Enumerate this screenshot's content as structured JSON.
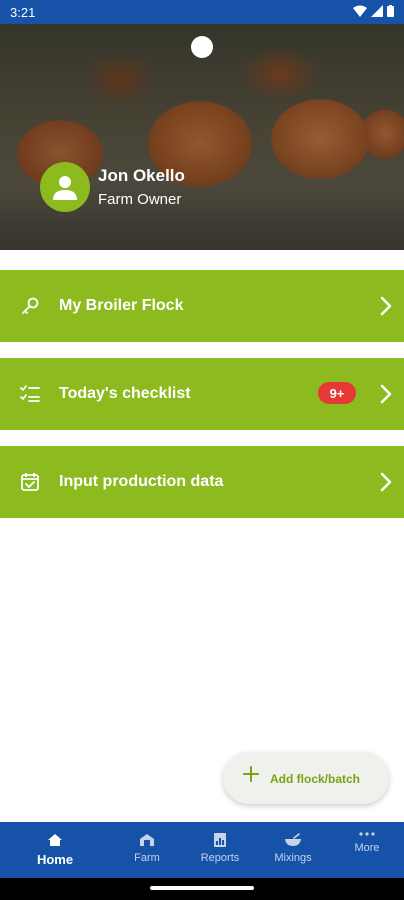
{
  "status_bar": {
    "time": "3:21"
  },
  "profile": {
    "name": "Jon Okello",
    "role": "Farm Owner"
  },
  "menu": [
    {
      "label": "My Broiler Flock",
      "icon": "key-icon"
    },
    {
      "label": "Today's checklist",
      "icon": "checklist-icon",
      "badge": "9+"
    },
    {
      "label": "Input production data",
      "icon": "calendar-check-icon"
    }
  ],
  "fab": {
    "label": "Add flock/batch",
    "icon": "plus-icon"
  },
  "nav": [
    {
      "label": "Home",
      "icon": "home-icon",
      "active": true
    },
    {
      "label": "Farm",
      "icon": "barn-icon"
    },
    {
      "label": "Reports",
      "icon": "report-icon"
    },
    {
      "label": "Mixings",
      "icon": "bowl-icon"
    },
    {
      "label": "More",
      "icon": "more-dots-icon"
    }
  ],
  "colors": {
    "primary": "#1552a8",
    "accent": "#8dbb1f",
    "badge": "#e53935"
  }
}
